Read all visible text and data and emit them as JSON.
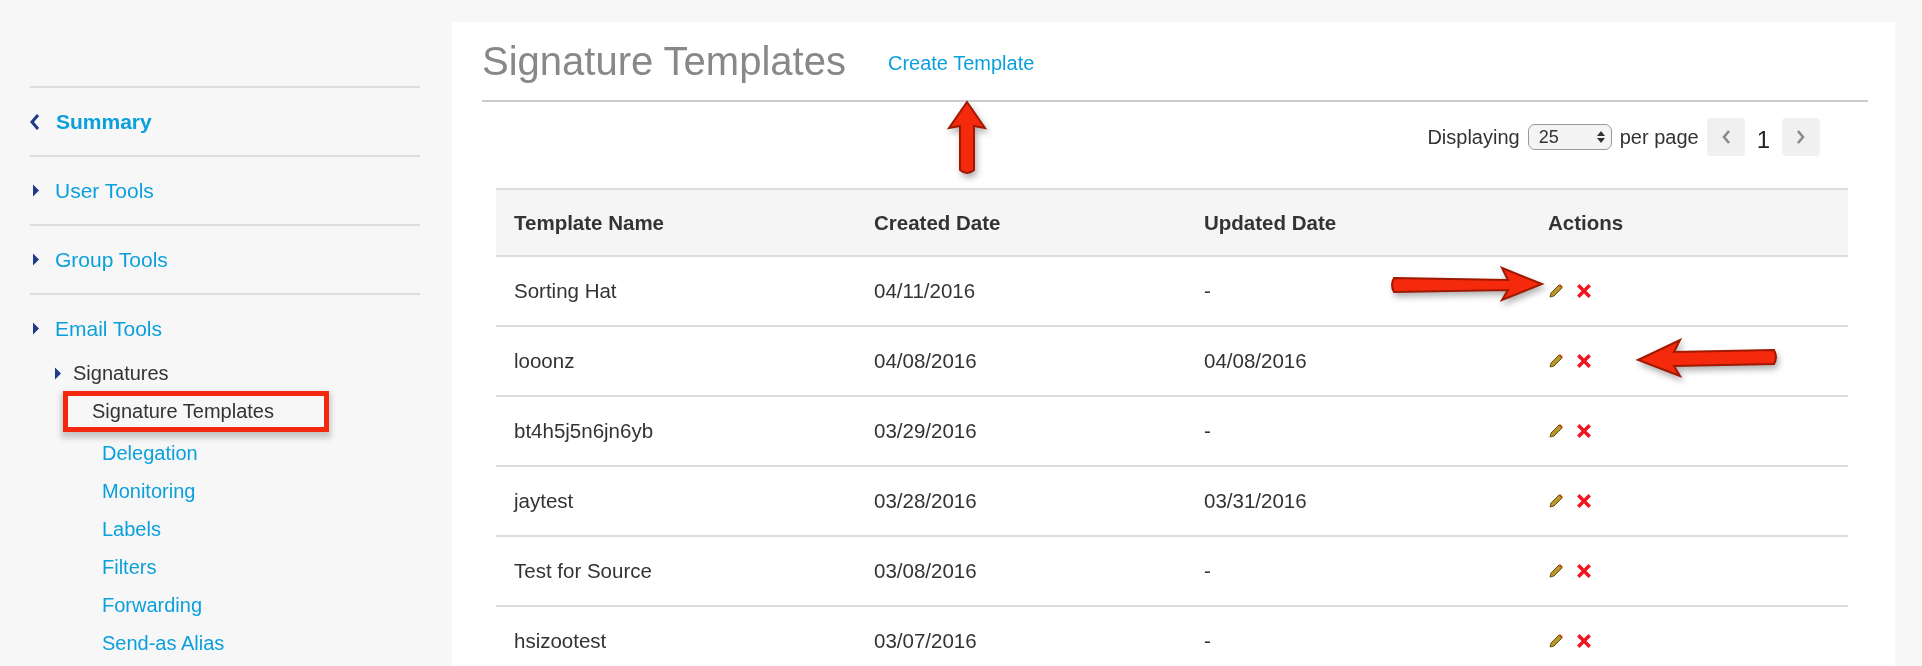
{
  "sidebar": {
    "items": [
      {
        "label": "Summary",
        "kind": "back"
      },
      {
        "label": "User Tools",
        "kind": "section"
      },
      {
        "label": "Group Tools",
        "kind": "section"
      },
      {
        "label": "Email Tools",
        "kind": "section",
        "children": [
          {
            "label": "Signatures",
            "kind": "group",
            "children": [
              {
                "label": "Signature Templates",
                "selected": true,
                "highlighted": true
              }
            ]
          },
          {
            "label": "Delegation",
            "kind": "link",
            "selected": false,
            "highlighted": false
          },
          {
            "label": "Monitoring",
            "kind": "link",
            "selected": false,
            "highlighted": false
          },
          {
            "label": "Labels",
            "kind": "link",
            "selected": false,
            "highlighted": false
          },
          {
            "label": "Filters",
            "kind": "link",
            "selected": false,
            "highlighted": false
          },
          {
            "label": "Forwarding",
            "kind": "link",
            "selected": false,
            "highlighted": false
          },
          {
            "label": "Send-as Alias",
            "kind": "link",
            "selected": false,
            "highlighted": false
          }
        ]
      }
    ]
  },
  "page": {
    "title": "Signature Templates",
    "create_link": "Create Template"
  },
  "pagination": {
    "label_before": "Displaying",
    "page_size": "25",
    "label_after": "per page",
    "current_page": "1"
  },
  "table": {
    "columns": [
      "Template Name",
      "Created Date",
      "Updated Date",
      "Actions"
    ],
    "rows": [
      {
        "name": "Sorting Hat",
        "created": "04/11/2016",
        "updated": "-"
      },
      {
        "name": "looonz",
        "created": "04/08/2016",
        "updated": "04/08/2016"
      },
      {
        "name": "bt4h5j5n6jn6yb",
        "created": "03/29/2016",
        "updated": "-"
      },
      {
        "name": "jaytest",
        "created": "03/28/2016",
        "updated": "03/31/2016"
      },
      {
        "name": "Test for Source",
        "created": "03/08/2016",
        "updated": "-"
      },
      {
        "name": "hsizootest",
        "created": "03/07/2016",
        "updated": "-"
      }
    ]
  }
}
